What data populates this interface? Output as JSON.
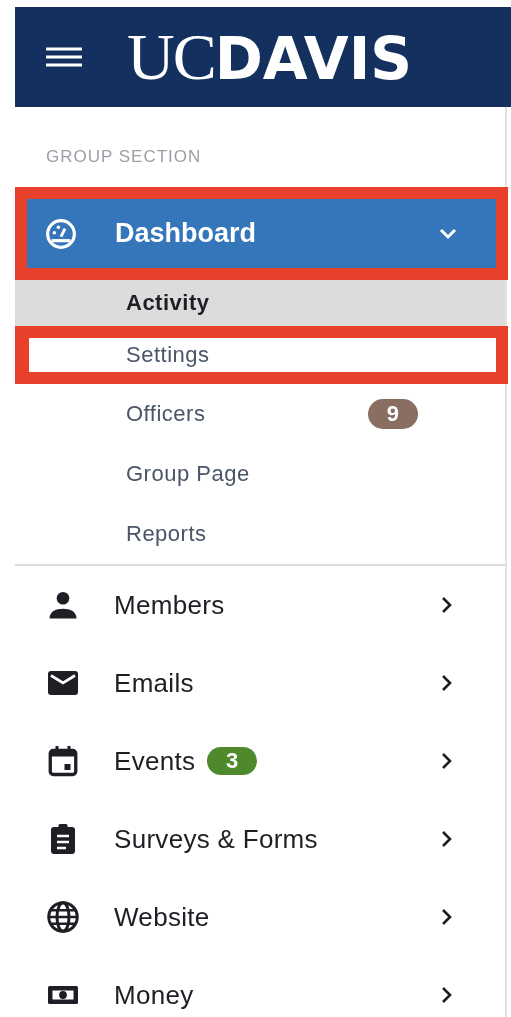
{
  "header": {
    "logo": {
      "part_1": "UC",
      "part_2": "DAVIS"
    }
  },
  "sidebar": {
    "section_label": "GROUP SECTION",
    "dashboard": {
      "label": "Dashboard",
      "expanded": true,
      "annotated": true
    },
    "subitems": [
      {
        "label": "Activity",
        "selected": true,
        "annotated": false
      },
      {
        "label": "Settings",
        "selected": false,
        "annotated": true
      },
      {
        "label": "Officers",
        "selected": false,
        "annotated": false,
        "badge": "9",
        "color": "#8a6e62"
      },
      {
        "label": "Group Page",
        "selected": false,
        "annotated": false
      },
      {
        "label": "Reports",
        "selected": false,
        "annotated": false
      }
    ],
    "items": [
      {
        "label": "Members"
      },
      {
        "label": "Emails"
      },
      {
        "label": "Events",
        "badge": "3",
        "color": "#4e8a2c"
      },
      {
        "label": "Surveys & Forms"
      },
      {
        "label": "Website"
      },
      {
        "label": "Money"
      }
    ]
  }
}
